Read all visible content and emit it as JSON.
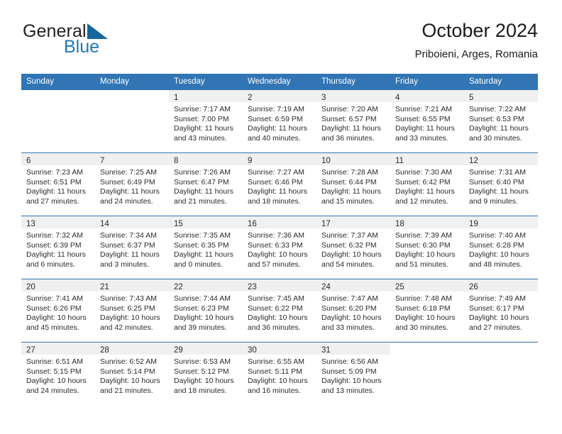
{
  "brand": {
    "name_part1": "General",
    "name_part2": "Blue",
    "triangle_icon": "triangle-icon",
    "accent_color": "#1c78c0",
    "header_color": "#3175b4"
  },
  "header": {
    "title": "October 2024",
    "subtitle": "Priboieni, Arges, Romania"
  },
  "weekdays": [
    "Sunday",
    "Monday",
    "Tuesday",
    "Wednesday",
    "Thursday",
    "Friday",
    "Saturday"
  ],
  "weeks": [
    [
      {
        "day": ""
      },
      {
        "day": ""
      },
      {
        "day": "1",
        "sunrise": "Sunrise: 7:17 AM",
        "sunset": "Sunset: 7:00 PM",
        "daylight_line1": "Daylight: 11 hours",
        "daylight_line2": "and 43 minutes."
      },
      {
        "day": "2",
        "sunrise": "Sunrise: 7:19 AM",
        "sunset": "Sunset: 6:59 PM",
        "daylight_line1": "Daylight: 11 hours",
        "daylight_line2": "and 40 minutes."
      },
      {
        "day": "3",
        "sunrise": "Sunrise: 7:20 AM",
        "sunset": "Sunset: 6:57 PM",
        "daylight_line1": "Daylight: 11 hours",
        "daylight_line2": "and 36 minutes."
      },
      {
        "day": "4",
        "sunrise": "Sunrise: 7:21 AM",
        "sunset": "Sunset: 6:55 PM",
        "daylight_line1": "Daylight: 11 hours",
        "daylight_line2": "and 33 minutes."
      },
      {
        "day": "5",
        "sunrise": "Sunrise: 7:22 AM",
        "sunset": "Sunset: 6:53 PM",
        "daylight_line1": "Daylight: 11 hours",
        "daylight_line2": "and 30 minutes."
      }
    ],
    [
      {
        "day": "6",
        "sunrise": "Sunrise: 7:23 AM",
        "sunset": "Sunset: 6:51 PM",
        "daylight_line1": "Daylight: 11 hours",
        "daylight_line2": "and 27 minutes."
      },
      {
        "day": "7",
        "sunrise": "Sunrise: 7:25 AM",
        "sunset": "Sunset: 6:49 PM",
        "daylight_line1": "Daylight: 11 hours",
        "daylight_line2": "and 24 minutes."
      },
      {
        "day": "8",
        "sunrise": "Sunrise: 7:26 AM",
        "sunset": "Sunset: 6:47 PM",
        "daylight_line1": "Daylight: 11 hours",
        "daylight_line2": "and 21 minutes."
      },
      {
        "day": "9",
        "sunrise": "Sunrise: 7:27 AM",
        "sunset": "Sunset: 6:46 PM",
        "daylight_line1": "Daylight: 11 hours",
        "daylight_line2": "and 18 minutes."
      },
      {
        "day": "10",
        "sunrise": "Sunrise: 7:28 AM",
        "sunset": "Sunset: 6:44 PM",
        "daylight_line1": "Daylight: 11 hours",
        "daylight_line2": "and 15 minutes."
      },
      {
        "day": "11",
        "sunrise": "Sunrise: 7:30 AM",
        "sunset": "Sunset: 6:42 PM",
        "daylight_line1": "Daylight: 11 hours",
        "daylight_line2": "and 12 minutes."
      },
      {
        "day": "12",
        "sunrise": "Sunrise: 7:31 AM",
        "sunset": "Sunset: 6:40 PM",
        "daylight_line1": "Daylight: 11 hours",
        "daylight_line2": "and 9 minutes."
      }
    ],
    [
      {
        "day": "13",
        "sunrise": "Sunrise: 7:32 AM",
        "sunset": "Sunset: 6:39 PM",
        "daylight_line1": "Daylight: 11 hours",
        "daylight_line2": "and 6 minutes."
      },
      {
        "day": "14",
        "sunrise": "Sunrise: 7:34 AM",
        "sunset": "Sunset: 6:37 PM",
        "daylight_line1": "Daylight: 11 hours",
        "daylight_line2": "and 3 minutes."
      },
      {
        "day": "15",
        "sunrise": "Sunrise: 7:35 AM",
        "sunset": "Sunset: 6:35 PM",
        "daylight_line1": "Daylight: 11 hours",
        "daylight_line2": "and 0 minutes."
      },
      {
        "day": "16",
        "sunrise": "Sunrise: 7:36 AM",
        "sunset": "Sunset: 6:33 PM",
        "daylight_line1": "Daylight: 10 hours",
        "daylight_line2": "and 57 minutes."
      },
      {
        "day": "17",
        "sunrise": "Sunrise: 7:37 AM",
        "sunset": "Sunset: 6:32 PM",
        "daylight_line1": "Daylight: 10 hours",
        "daylight_line2": "and 54 minutes."
      },
      {
        "day": "18",
        "sunrise": "Sunrise: 7:39 AM",
        "sunset": "Sunset: 6:30 PM",
        "daylight_line1": "Daylight: 10 hours",
        "daylight_line2": "and 51 minutes."
      },
      {
        "day": "19",
        "sunrise": "Sunrise: 7:40 AM",
        "sunset": "Sunset: 6:28 PM",
        "daylight_line1": "Daylight: 10 hours",
        "daylight_line2": "and 48 minutes."
      }
    ],
    [
      {
        "day": "20",
        "sunrise": "Sunrise: 7:41 AM",
        "sunset": "Sunset: 6:26 PM",
        "daylight_line1": "Daylight: 10 hours",
        "daylight_line2": "and 45 minutes."
      },
      {
        "day": "21",
        "sunrise": "Sunrise: 7:43 AM",
        "sunset": "Sunset: 6:25 PM",
        "daylight_line1": "Daylight: 10 hours",
        "daylight_line2": "and 42 minutes."
      },
      {
        "day": "22",
        "sunrise": "Sunrise: 7:44 AM",
        "sunset": "Sunset: 6:23 PM",
        "daylight_line1": "Daylight: 10 hours",
        "daylight_line2": "and 39 minutes."
      },
      {
        "day": "23",
        "sunrise": "Sunrise: 7:45 AM",
        "sunset": "Sunset: 6:22 PM",
        "daylight_line1": "Daylight: 10 hours",
        "daylight_line2": "and 36 minutes."
      },
      {
        "day": "24",
        "sunrise": "Sunrise: 7:47 AM",
        "sunset": "Sunset: 6:20 PM",
        "daylight_line1": "Daylight: 10 hours",
        "daylight_line2": "and 33 minutes."
      },
      {
        "day": "25",
        "sunrise": "Sunrise: 7:48 AM",
        "sunset": "Sunset: 6:18 PM",
        "daylight_line1": "Daylight: 10 hours",
        "daylight_line2": "and 30 minutes."
      },
      {
        "day": "26",
        "sunrise": "Sunrise: 7:49 AM",
        "sunset": "Sunset: 6:17 PM",
        "daylight_line1": "Daylight: 10 hours",
        "daylight_line2": "and 27 minutes."
      }
    ],
    [
      {
        "day": "27",
        "sunrise": "Sunrise: 6:51 AM",
        "sunset": "Sunset: 5:15 PM",
        "daylight_line1": "Daylight: 10 hours",
        "daylight_line2": "and 24 minutes."
      },
      {
        "day": "28",
        "sunrise": "Sunrise: 6:52 AM",
        "sunset": "Sunset: 5:14 PM",
        "daylight_line1": "Daylight: 10 hours",
        "daylight_line2": "and 21 minutes."
      },
      {
        "day": "29",
        "sunrise": "Sunrise: 6:53 AM",
        "sunset": "Sunset: 5:12 PM",
        "daylight_line1": "Daylight: 10 hours",
        "daylight_line2": "and 18 minutes."
      },
      {
        "day": "30",
        "sunrise": "Sunrise: 6:55 AM",
        "sunset": "Sunset: 5:11 PM",
        "daylight_line1": "Daylight: 10 hours",
        "daylight_line2": "and 16 minutes."
      },
      {
        "day": "31",
        "sunrise": "Sunrise: 6:56 AM",
        "sunset": "Sunset: 5:09 PM",
        "daylight_line1": "Daylight: 10 hours",
        "daylight_line2": "and 13 minutes."
      },
      {
        "day": ""
      },
      {
        "day": ""
      }
    ]
  ]
}
